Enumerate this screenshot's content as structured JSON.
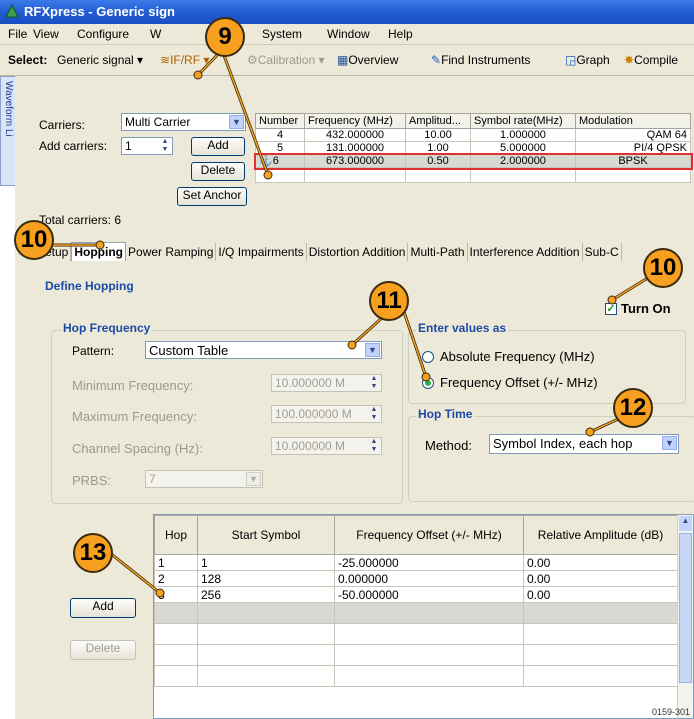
{
  "window": {
    "title": "RFXpress - Generic sign"
  },
  "menu": [
    "File",
    "View",
    "Configure",
    "W",
    "System",
    "Window",
    "Help"
  ],
  "toolbar": {
    "select_label": "Select:",
    "generic_signal": "Generic signal",
    "if_rf": "IF/RF",
    "calibration": "Calibration",
    "overview": "Overview",
    "find_instruments": "Find Instruments",
    "graph": "Graph",
    "compile": "Compile"
  },
  "side_tab": "Waveform Li",
  "carriers": {
    "carriers_label": "Carriers:",
    "carriers_value": "Multi Carrier",
    "add_carriers_label": "Add carriers:",
    "add_count": "1",
    "add_button": "Add",
    "delete_button": "Delete",
    "set_anchor_button": "Set Anchor",
    "total_label": "Total carriers:",
    "total_value": "6",
    "columns": [
      "Number",
      "Frequency (MHz)",
      "Amplitud...",
      "Symbol rate(MHz)",
      "Modulation"
    ],
    "rows": [
      [
        "4",
        "432.000000",
        "10.00",
        "1.000000",
        "QAM 64"
      ],
      [
        "5",
        "131.000000",
        "1.00",
        "5.000000",
        "PI/4 QPSK"
      ],
      [
        "6",
        "673.000000",
        "0.50",
        "2.000000",
        "BPSK"
      ]
    ]
  },
  "tabs": [
    "Setup",
    "Hopping",
    "Power Ramping",
    "I/Q Impairments",
    "Distortion Addition",
    "Multi-Path",
    "Interference Addition",
    "Sub-C"
  ],
  "active_tab": "Hopping",
  "hopping": {
    "define_title": "Define Hopping",
    "turn_on_label": "Turn On",
    "turn_on_checked": true,
    "hop_frequency_title": "Hop Frequency",
    "pattern_label": "Pattern:",
    "pattern_value": "Custom Table",
    "min_freq_label": "Minimum Frequency:",
    "min_freq_value": "10.000000 M",
    "max_freq_label": "Maximum Frequency:",
    "max_freq_value": "100.000000 M",
    "spacing_label": "Channel Spacing (Hz):",
    "spacing_value": "10.000000 M",
    "prbs_label": "PRBS:",
    "prbs_value": "7",
    "enter_values_title": "Enter values as",
    "abs_freq_label": "Absolute Frequency (MHz)",
    "freq_offset_label": "Frequency Offset (+/- MHz)",
    "selected_mode": "Frequency Offset (+/- MHz)",
    "hop_time_title": "Hop Time",
    "method_label": "Method:",
    "method_value": "Symbol Index, each hop"
  },
  "hop_table": {
    "add_button": "Add",
    "delete_button": "Delete",
    "columns": [
      "Hop",
      "Start Symbol",
      "Frequency Offset (+/- MHz)",
      "Relative Amplitude (dB)"
    ],
    "rows": [
      [
        "1",
        "1",
        "-25.000000",
        "0.00"
      ],
      [
        "2",
        "128",
        "0.000000",
        "0.00"
      ],
      [
        "3",
        "256",
        "-50.000000",
        "0.00"
      ]
    ]
  },
  "callouts": [
    "9",
    "10",
    "10",
    "11",
    "12",
    "13"
  ],
  "footer_code": "0159-301",
  "colors": {
    "callout": "#f7a020",
    "title_bar": "#2c64d8",
    "group_title": "#1c4aa6",
    "selected_row_outline": "#e03030"
  }
}
